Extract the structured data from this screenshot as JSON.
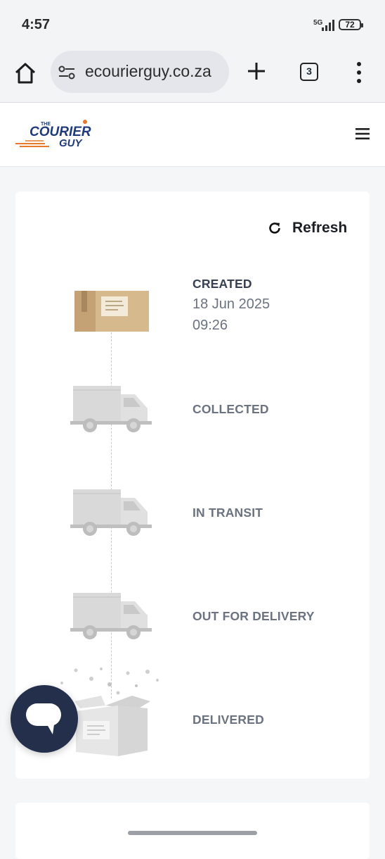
{
  "status_bar": {
    "time": "4:57",
    "network": "5G",
    "battery": "72"
  },
  "browser": {
    "url": "ecourierguy.co.za",
    "tab_count": "3",
    "icons": [
      "home-icon",
      "site-controls-icon",
      "plus-icon",
      "tabs-icon",
      "more-vert-icon"
    ]
  },
  "site": {
    "logo_text_the": "THE",
    "logo_text_courier": "COURIER",
    "logo_text_guy": "GUY"
  },
  "tracking": {
    "refresh_label": "Refresh",
    "steps": [
      {
        "label": "CREATED",
        "date": "18 Jun 2025",
        "time": "09:26",
        "status": "complete",
        "icon": "parcel-icon"
      },
      {
        "label": "COLLECTED",
        "status": "pending",
        "icon": "truck-icon"
      },
      {
        "label": "IN TRANSIT",
        "status": "pending",
        "icon": "truck-icon"
      },
      {
        "label": "OUT FOR DELIVERY",
        "status": "pending",
        "icon": "truck-icon"
      },
      {
        "label": "DELIVERED",
        "status": "pending",
        "icon": "open-box-icon"
      }
    ]
  },
  "colors": {
    "brand_navy": "#1f3b7a",
    "brand_orange": "#e8782a",
    "chat_fab": "#232f4b",
    "parcel": "#d7b98e"
  }
}
